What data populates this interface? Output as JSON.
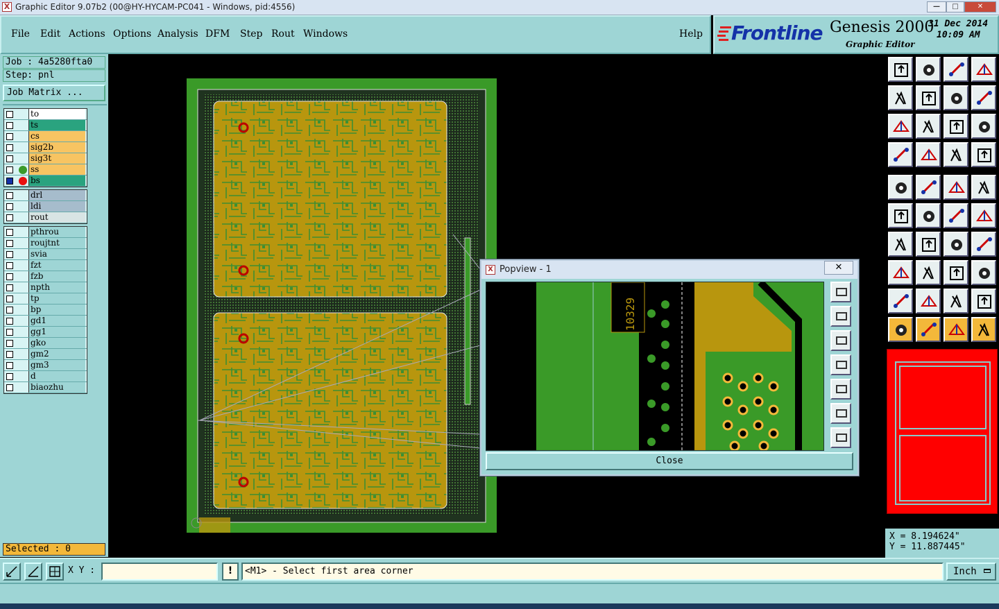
{
  "window": {
    "title": "Graphic Editor 9.07b2 (00@HY-HYCAM-PC041 - Windows, pid:4556)",
    "icon": "X"
  },
  "window_controls": {
    "minimize": "—",
    "maximize": "□",
    "close": "✕"
  },
  "menu": {
    "items": [
      "File",
      "Edit",
      "Actions",
      "Options",
      "Analysis",
      "DFM",
      "Step",
      "Rout",
      "Windows"
    ],
    "help": "Help"
  },
  "logo": {
    "brand": "Frontline",
    "product": "Genesis 2000",
    "subtitle": "Graphic Editor",
    "date": "31 Dec 2014",
    "time": "10:09 AM"
  },
  "job": {
    "job_label": "Job : 4a5280fta0",
    "step_label": "Step: pnl",
    "matrix_button": "Job Matrix ..."
  },
  "layers_group1": [
    {
      "name": "to",
      "color": "#ffffff",
      "dot": ""
    },
    {
      "name": "ts",
      "color": "#2aa37f",
      "dot": ""
    },
    {
      "name": "cs",
      "color": "#f7c462",
      "dot": ""
    },
    {
      "name": "sig2b",
      "color": "#f7c462",
      "dot": ""
    },
    {
      "name": "sig3t",
      "color": "#f7c462",
      "dot": ""
    },
    {
      "name": "ss",
      "color": "#f7c462",
      "dot": "#3a9a2a"
    },
    {
      "name": "bs",
      "color": "#2aa37f",
      "dot": "#e81010"
    }
  ],
  "layers_group2": [
    {
      "name": "drl",
      "color": "#a6bccc"
    },
    {
      "name": "ldi",
      "color": "#a6bccc"
    },
    {
      "name": "rout",
      "color": "#d8e4e4"
    }
  ],
  "layers_group3": [
    "pthrou",
    "roujtnt",
    "svia",
    "fzt",
    "fzb",
    "npth",
    "tp",
    "bp",
    "gd1",
    "gg1",
    "gko",
    "gm2",
    "gm3",
    "d",
    "biaozhu"
  ],
  "layers_group3_color": "#9ed5d5",
  "selected": "Selected : 0",
  "popview": {
    "title": "Popview - 1",
    "close_label": "Close",
    "board_text": "10329"
  },
  "coords": {
    "x": "X = 8.194624\"",
    "y": "Y = 11.887445\""
  },
  "status": {
    "xy_label": "X Y :",
    "xy_value": "",
    "alert": "!",
    "prompt": "<M1> - Select first area corner",
    "units": "Inch"
  },
  "tool_icons": [
    "zoom-home-icon",
    "pan-down-icon",
    "house-icon",
    "split-window-icon",
    "pan-left-icon",
    "pan-right-icon",
    "swap-view-icon",
    "redraw-icon",
    "fit-screen-icon",
    "zoom-fit-icon",
    "scale-1-2-icon",
    "help-icon",
    "measure-icon",
    "grid-icon",
    "layers-a-icon",
    "layers-b-icon",
    "snap-icon",
    "color-icon",
    "ruler-icon",
    "pad-icon",
    "feature-add-icon",
    "cross-icon",
    "line-icon",
    "line-2-icon",
    "angle-icon",
    "slash-icon",
    "arc-icon",
    "mirror-icon",
    "move-icon",
    "delete-line-icon",
    "distance-icon",
    "shape-icon",
    "triangle-icon",
    "triangle-a-icon",
    "triangle-b-icon",
    "triangle-c-icon",
    "pointer-icon",
    "select-icon",
    "select-2-icon",
    "select-3-icon"
  ]
}
